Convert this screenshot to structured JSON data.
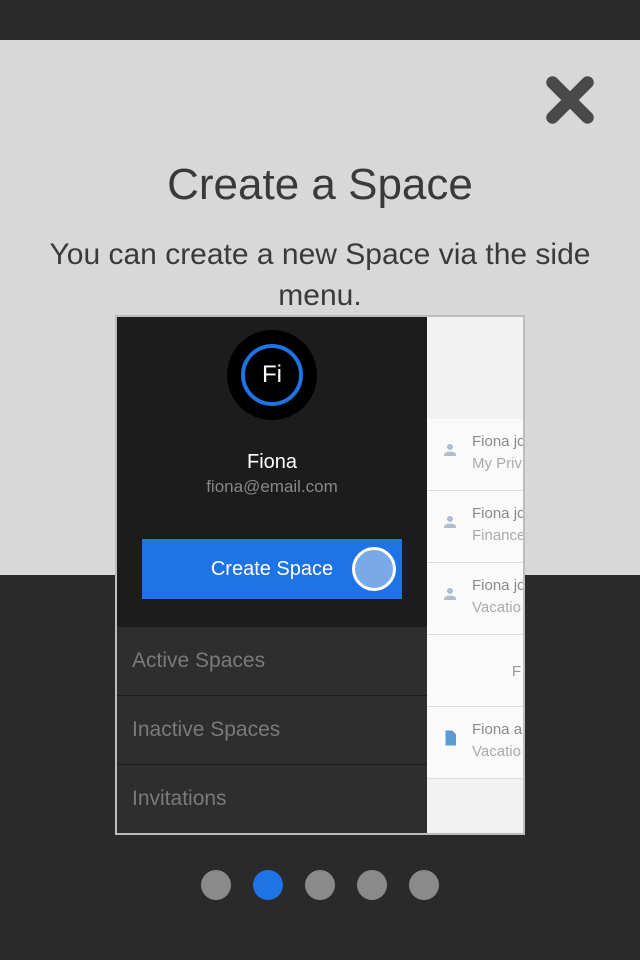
{
  "tutorial": {
    "title": "Create a Space",
    "subtitle": "You can create a new Space via the side menu."
  },
  "user": {
    "initials": "Fi",
    "name": "Fiona",
    "email": "fiona@email.com"
  },
  "sidemenu": {
    "create_button": "Create Space",
    "sections": {
      "active": "Active Spaces",
      "inactive": "Inactive Spaces",
      "invitations": "Invitations"
    }
  },
  "feed": {
    "items": [
      {
        "line1": "Fiona jo",
        "line2": "My Priv"
      },
      {
        "line1": "Fiona jo",
        "line2": "Finance"
      },
      {
        "line1": "Fiona jo",
        "line2": "Vacatio"
      },
      {
        "line1": "Fiona a",
        "line2": "Vacatio"
      }
    ],
    "center_label": "F"
  },
  "pagination": {
    "total": 5,
    "active_index": 1
  }
}
